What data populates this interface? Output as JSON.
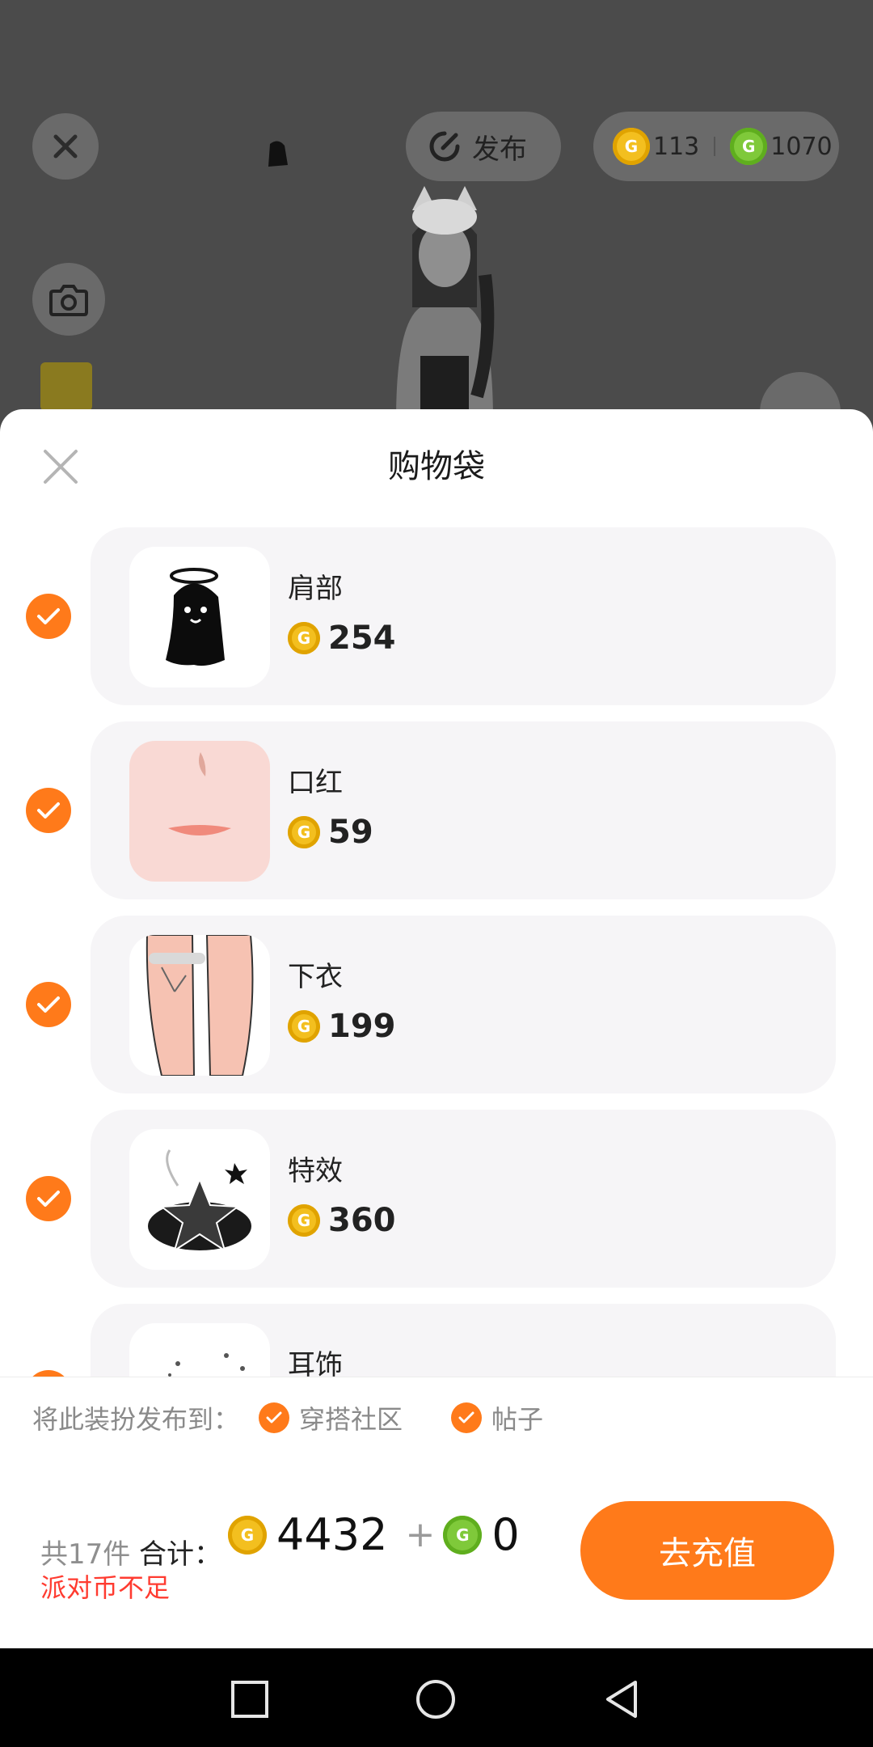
{
  "topbar": {
    "publish_label": "发布",
    "gold_coins": "113",
    "green_coins": "1070"
  },
  "sheet": {
    "title": "购物袋",
    "items": [
      {
        "name": "肩部",
        "price": "254",
        "checked": true
      },
      {
        "name": "口红",
        "price": "59",
        "checked": true
      },
      {
        "name": "下衣",
        "price": "199",
        "checked": true
      },
      {
        "name": "特效",
        "price": "360",
        "checked": true
      },
      {
        "name": "耳饰",
        "price": "",
        "checked": true
      }
    ]
  },
  "publish": {
    "label": "将此装扮发布到：",
    "options": [
      "穿搭社区",
      "帖子"
    ]
  },
  "footer": {
    "count": "共17件",
    "total_label": "合计：",
    "gold_total": "4432",
    "plus": "+",
    "green_total": "0",
    "warning": "派对币不足",
    "recharge_button": "去充值"
  },
  "icons": {
    "close": "close-icon",
    "camera": "camera-icon",
    "publish": "publish-icon",
    "check": "check-icon",
    "coin_gold": "gold-coin-icon",
    "coin_green": "green-coin-icon",
    "nav": [
      "recent-apps-icon",
      "home-icon",
      "back-icon"
    ]
  },
  "colors": {
    "accent": "#ff7a1a",
    "warning": "#ff3b30",
    "gold": "#f3bf1f",
    "green": "#7fc93a"
  }
}
